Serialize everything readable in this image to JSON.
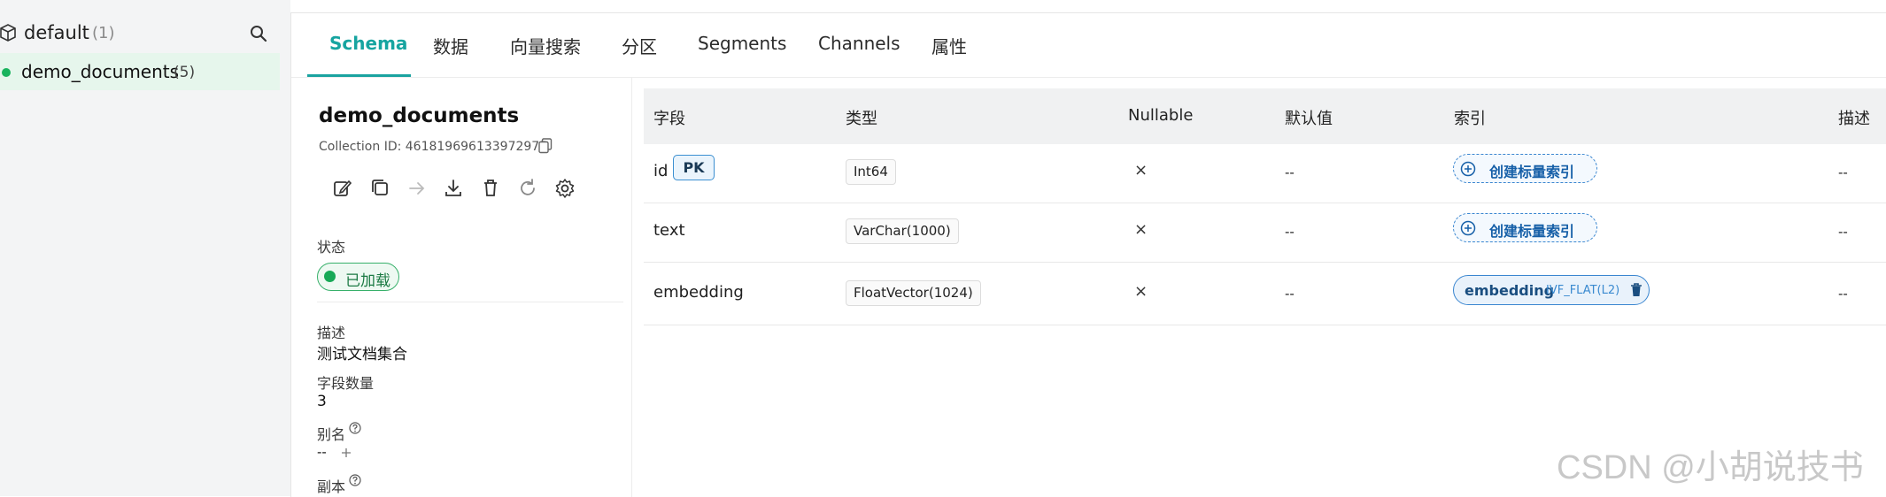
{
  "sidebar": {
    "database": {
      "name": "default",
      "count": "(1)"
    },
    "collection": {
      "name": "demo_documents",
      "count": "(5)"
    }
  },
  "tabs": [
    {
      "label": "Schema",
      "active": true
    },
    {
      "label": "数据"
    },
    {
      "label": "向量搜索"
    },
    {
      "label": "分区"
    },
    {
      "label": "Segments"
    },
    {
      "label": "Channels"
    },
    {
      "label": "属性"
    }
  ],
  "details": {
    "title": "demo_documents",
    "collection_id": "Collection ID: 461819696133972975",
    "status_label": "状态",
    "status_value": "已加载",
    "description_label": "描述",
    "description_value": "测试文档集合",
    "field_count_label": "字段数量",
    "field_count_value": "3",
    "alias_label": "别名",
    "alias_value": "--",
    "replica_label": "副本"
  },
  "table": {
    "headers": [
      "字段",
      "类型",
      "Nullable",
      "默认值",
      "索引",
      "描述"
    ],
    "rows": [
      {
        "field": "id",
        "pk": "PK",
        "type": "Int64",
        "nullable": "×",
        "default": "--",
        "index_action": "创建标量索引",
        "desc": "--"
      },
      {
        "field": "text",
        "type": "VarChar(1000)",
        "nullable": "×",
        "default": "--",
        "index_action": "创建标量索引",
        "desc": "--"
      },
      {
        "field": "embedding",
        "type": "FloatVector(1024)",
        "nullable": "×",
        "default": "--",
        "index_name": "embedding",
        "index_type": "IVF_FLAT(L2)",
        "desc": "--"
      }
    ]
  },
  "watermark": "CSDN @小胡说技书",
  "colors": {
    "accent": "#1aa3a0",
    "loaded": "#18a957",
    "index_blue": "#3a86d0"
  }
}
